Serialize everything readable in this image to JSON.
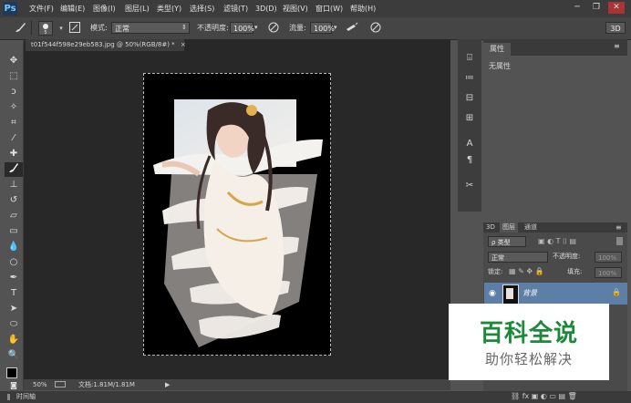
{
  "app": {
    "logo": "Ps"
  },
  "menu": [
    "文件(F)",
    "编辑(E)",
    "图像(I)",
    "图层(L)",
    "类型(Y)",
    "选择(S)",
    "滤镜(T)",
    "3D(D)",
    "视图(V)",
    "窗口(W)",
    "帮助(H)"
  ],
  "window_controls": {
    "minimize": "─",
    "restore": "❐",
    "close": "✕"
  },
  "options": {
    "mode_label": "模式:",
    "mode_value": "正常",
    "opacity_label": "不透明度:",
    "opacity_value": "100%",
    "flow_label": "流量:",
    "flow_value": "100%",
    "workspace": "3D"
  },
  "document": {
    "tab_title": "t01f544f598e29eb583.jpg @ 50%(RGB/8#) *",
    "tab_close": "×"
  },
  "status": {
    "zoom": "50%",
    "doc_info": "文档:1.81M/1.81M"
  },
  "timeline": {
    "label": "时间轴"
  },
  "properties": {
    "tab": "属性",
    "content": "无属性"
  },
  "layers": {
    "tabs": [
      "3D",
      "图层",
      "通道"
    ],
    "filter_kind": "ρ 类型",
    "blend_mode": "正常",
    "opacity_label": "不透明度:",
    "opacity_value": "100%",
    "lock_label": "锁定:",
    "fill_label": "填充:",
    "fill_value": "100%",
    "layer_name": "背景"
  },
  "watermark": {
    "title": "百科全说",
    "subtitle": "助你轻松解决"
  },
  "colors": {
    "accent": "#5d7ea7",
    "watermark_green": "#1d8a3a",
    "canvas": "#000000"
  }
}
